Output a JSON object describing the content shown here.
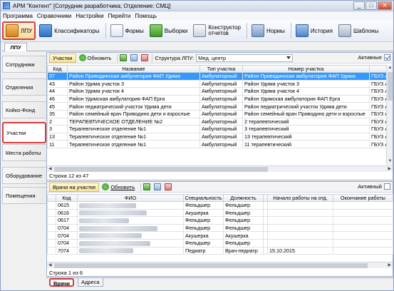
{
  "window": {
    "title": "АРМ \"Контент\" [Сотрудник разработчика; Отделение: СМЦ]",
    "minimize": "_",
    "maximize": "□",
    "close": "✕"
  },
  "menu": [
    "Программа",
    "Справочники",
    "Настройки",
    "Перейти",
    "Помощь"
  ],
  "toolbar": {
    "lpu": "ЛПУ",
    "classifiers": "Классификаторы",
    "forms": "Формы",
    "selections": "Выборки",
    "constructor_l1": "Конструктор",
    "constructor_l2": "отчетов",
    "norms": "Нормы",
    "history": "История",
    "templates": "Шаблоны"
  },
  "top_tab": "ЛПУ",
  "nav": [
    "Сотрудники",
    "Отделения",
    "Койко-Фонд",
    "Участки",
    "Места работы",
    "Оборудование",
    "Помещения"
  ],
  "sites": {
    "label": "Участки",
    "refresh": "Обновить",
    "structure_label": "Структура ЛПУ:",
    "structure_value": "Мед. центр",
    "active_label": "Активные",
    "active": true,
    "columns": [
      "Код",
      "Название",
      "Тип участка",
      "Номер участка",
      ""
    ],
    "rows": [
      [
        "37",
        "Район Приводинская амбулатория ФАП Удима",
        "Амбулаторный",
        "Район Приводинская амбулатория ФАП Удима",
        "ГБУЗ А"
      ],
      [
        "43",
        "Район Удима участок 3",
        "Амбулаторный",
        "Район Удима участок 3",
        "ГБУЗ А"
      ],
      [
        "44",
        "Район Удима участок 4",
        "Амбулаторный",
        "Район Удима участок 4",
        "ГБУЗ А"
      ],
      [
        "46",
        "Район Удимская амбулатория ФАП Ерга",
        "Амбулаторный",
        "Район Удимская амбулатория ФАП Ерга",
        "ГБУЗ А"
      ],
      [
        "45",
        "Район педиатрический участок Удима дети",
        "Амбулаторный",
        "Район педиатрический участок Удима дети",
        "ГБУЗ А"
      ],
      [
        "35",
        "Район семейный врач Приводино дети и взрослые",
        "Амбулаторный",
        "Район семейный врач Приводино дети и взрослые",
        "ГБУЗ А"
      ],
      [
        "2",
        "ТЕРАПЕВТИЧЕСКОЕ ОТДЕЛЕНИЕ №2",
        "Амбулаторный",
        "2 терапевтический",
        "ГБУЗ А"
      ],
      [
        "3",
        "Терапевтическое отделение №1",
        "Амбулаторный",
        "3 терапевтический",
        "ГБУЗ А"
      ],
      [
        "13",
        "Терапевтическое отделение №1",
        "Амбулаторный",
        "13 терапевтический",
        "ГБУЗ А"
      ],
      [
        "11",
        "Терапевтическое отделение №1",
        "Амбулаторный",
        "11 терапевтический",
        "ГБУЗ А"
      ]
    ],
    "status": "Строка 12 из 47"
  },
  "doctors": {
    "label": "Врачи на участке",
    "refresh": "Обновить",
    "active_label": "Активный",
    "active": false,
    "columns": [
      "",
      "Код",
      "ФИО",
      "Специальность",
      "Должность",
      "",
      "Начало работы на отд.",
      "Окончание работы"
    ],
    "rows": [
      [
        "0615",
        "Фельдшер",
        "Фельдшер",
        ""
      ],
      [
        "0616",
        "Акушерка",
        "Фельдшер",
        ""
      ],
      [
        "0617",
        "Фельдшер",
        "Фельдшер",
        ""
      ],
      [
        "0704",
        "Фельдшер",
        "Фельдшер",
        ""
      ],
      [
        "0704",
        "Акушерка",
        "Акушерка",
        ""
      ],
      [
        "0704",
        "Фельдшер",
        "Фельдшер",
        ""
      ],
      [
        "7074",
        "Педиатр",
        "Врач-педиатр",
        "15.10.2015"
      ]
    ],
    "status": "Строка 1 из 6"
  },
  "bottom_tabs": [
    "Врачи",
    "Адреса"
  ]
}
